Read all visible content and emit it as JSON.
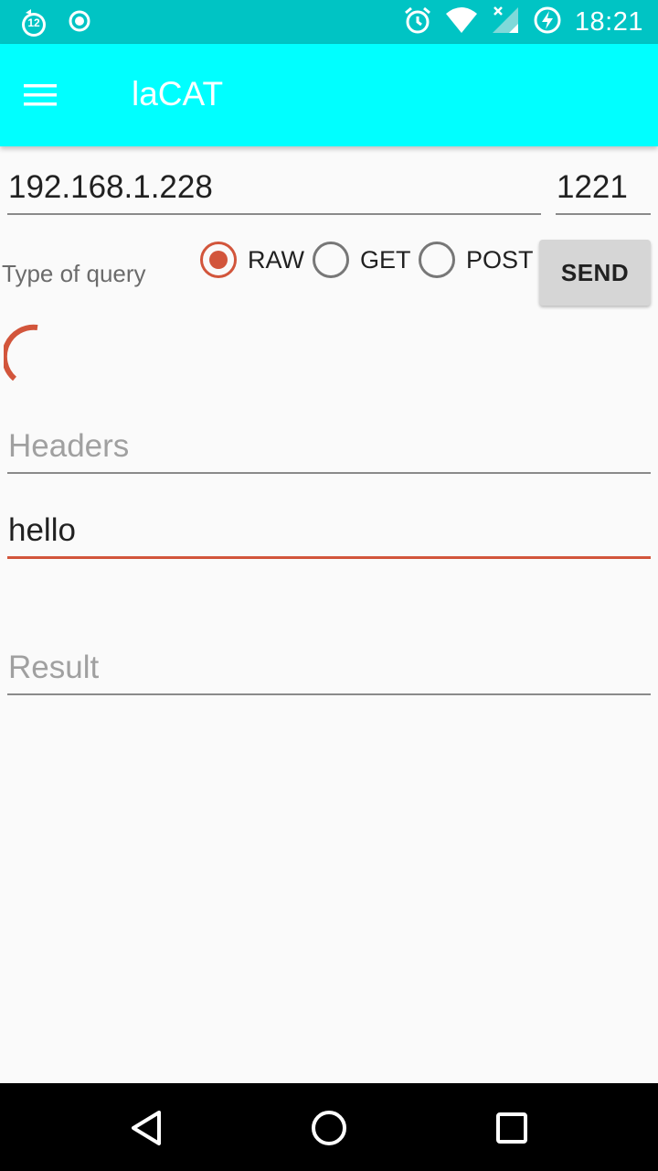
{
  "status_bar": {
    "time": "18:21",
    "notification_badge": "12",
    "icons": [
      "notification-badge-icon",
      "target-icon",
      "alarm-icon",
      "wifi-icon",
      "signal-icon",
      "battery-charging-icon"
    ]
  },
  "app_bar": {
    "title": "laCAT",
    "menu_icon": "hamburger-menu-icon"
  },
  "connection": {
    "ip_value": "192.168.1.228",
    "port_value": "1221"
  },
  "query": {
    "label": "Type of query",
    "options": [
      {
        "label": "RAW",
        "checked": true
      },
      {
        "label": "GET",
        "checked": false
      },
      {
        "label": "POST",
        "checked": false
      }
    ],
    "send_label": "SEND"
  },
  "headers": {
    "placeholder": "Headers",
    "value": ""
  },
  "body": {
    "value": "hello"
  },
  "result": {
    "placeholder": "Result",
    "value": ""
  },
  "nav_bar": {
    "icons": [
      "back-icon",
      "home-icon",
      "recents-icon"
    ]
  },
  "colors": {
    "status_bar": "#00c4c4",
    "app_bar": "#00ffff",
    "accent": "#d2553b",
    "background": "#fafafa"
  }
}
